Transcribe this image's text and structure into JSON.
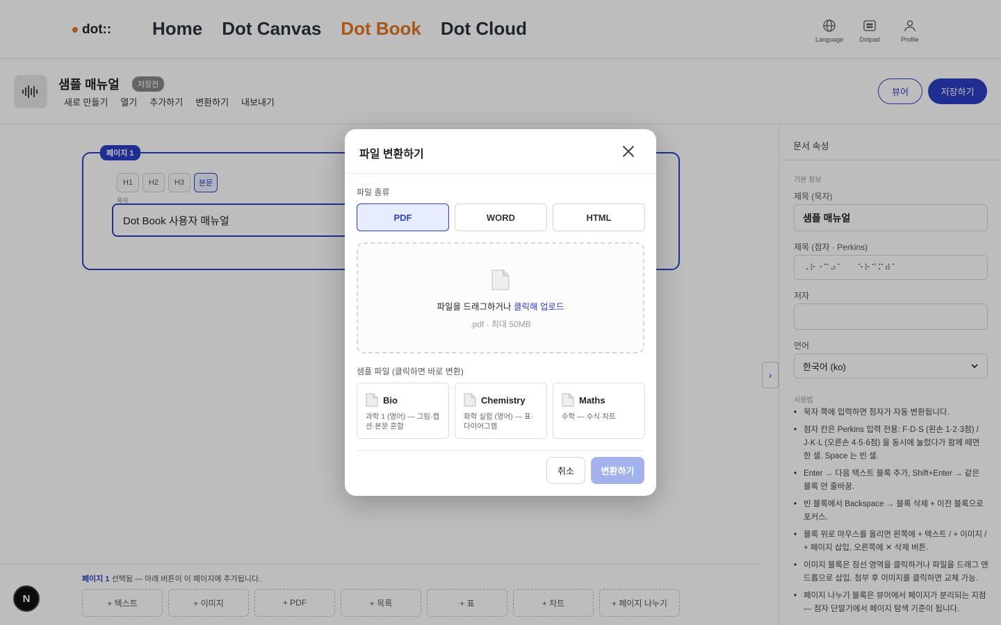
{
  "nav": {
    "logo": "dot::",
    "links": [
      "Home",
      "Dot Canvas",
      "Dot Book",
      "Dot Cloud"
    ],
    "active_link": "Dot Book",
    "icons": [
      {
        "label": "Language",
        "icon": "globe-icon"
      },
      {
        "label": "Dotpad",
        "icon": "dotpad-icon"
      },
      {
        "label": "Profile",
        "icon": "person-icon"
      }
    ]
  },
  "toolbar": {
    "doc_title": "샘플 매뉴얼",
    "badge": "저장전",
    "menu": [
      "새로 만들기",
      "열기",
      "추가하기",
      "변환하기",
      "내보내기"
    ],
    "viewer_label": "뷰어",
    "save_label": "저장하기"
  },
  "editor": {
    "page_label": "페이지 1",
    "heading_buttons": [
      "H1",
      "H2",
      "H3",
      "본문"
    ],
    "active_heading": "본문",
    "field_label": "묵자",
    "title_value": "Dot Book 사용자 매뉴얼",
    "bottom_info_page": "페이지 1",
    "bottom_info_text": " 선택됨 — 아래 버튼이 이 페이지에 추가됩니다.",
    "add_buttons": [
      "+ 텍스트",
      "+ 이미지",
      "+ PDF",
      "+ 목록",
      "+ 표",
      "+ 차트",
      "+ 페이지 나누기"
    ],
    "n_badge": "N"
  },
  "right_panel": {
    "title": "문서 속성",
    "section_basic": "기본 정보",
    "title_label": "제목 (묵자)",
    "title_value": "샘플 매뉴얼",
    "braille_label": "제목 (점자 · Perkins)",
    "braille_value": "⠠⠗⠐⠉⠴⠁⠀⠀⠑⠗⠉⠍⠾⠁",
    "author_label": "저자",
    "author_value": "",
    "language_label": "언어",
    "language_value": "한국어 (ko)",
    "section_usage": "사용법",
    "usage": [
      "묵자 쪽에 입력하면 점자가 자동 변환됩니다.",
      "점자 칸은 Perkins 입력 전용: F·D·S (왼손 1·2·3점) / J·K·L (오른손 4·5·6점) 을 동시에 눌렀다가 함께 떼면 한 셀. Space 는 빈 셀.",
      "Enter → 다음 텍스트 블록 추가, Shift+Enter → 같은 블록 안 줄바꿈.",
      "빈 블록에서 Backspace → 블록 삭제 + 이전 블록으로 포커스.",
      "블록 위로 마우스를 올리면 왼쪽에 + 텍스트 / + 이미지 / + 페이지 삽입, 오른쪽에 ✕ 삭제 버튼.",
      "이미지 블록은 점선 영역을 클릭하거나 파일을 드래그 앤 드롭으로 삽입. 첨부 후 이미지를 클릭하면 교체 가능.",
      "페이지 나누기 블록은 뷰어에서 페이지가 분리되는 지점 — 점자 단말기에서 페이지 탐색 기준이 됩니다."
    ]
  },
  "modal": {
    "title": "파일 변환하기",
    "file_type_label": "파일 종류",
    "file_types": [
      "PDF",
      "WORD",
      "HTML"
    ],
    "active_type": "PDF",
    "drop_text": "파일을 드래그하거나 ",
    "drop_link": "클릭해 업로드",
    "drop_hint": ".pdf · 최대 50MB",
    "samples_label": "샘플 파일 (클릭하면 바로 변환)",
    "samples": [
      {
        "name": "Bio",
        "desc": "과학 1 (영어) — 그림·캡션·본문 혼합"
      },
      {
        "name": "Chemistry",
        "desc": "화학 실험 (영어) — 표·다이어그램"
      },
      {
        "name": "Maths",
        "desc": "수학 — 수식·차트"
      }
    ],
    "cancel_label": "취소",
    "convert_label": "변환하기"
  },
  "colors": {
    "accent": "#2d3fc4",
    "brand_orange": "#e2741f",
    "convert_disabled": "#a3b1ed"
  }
}
